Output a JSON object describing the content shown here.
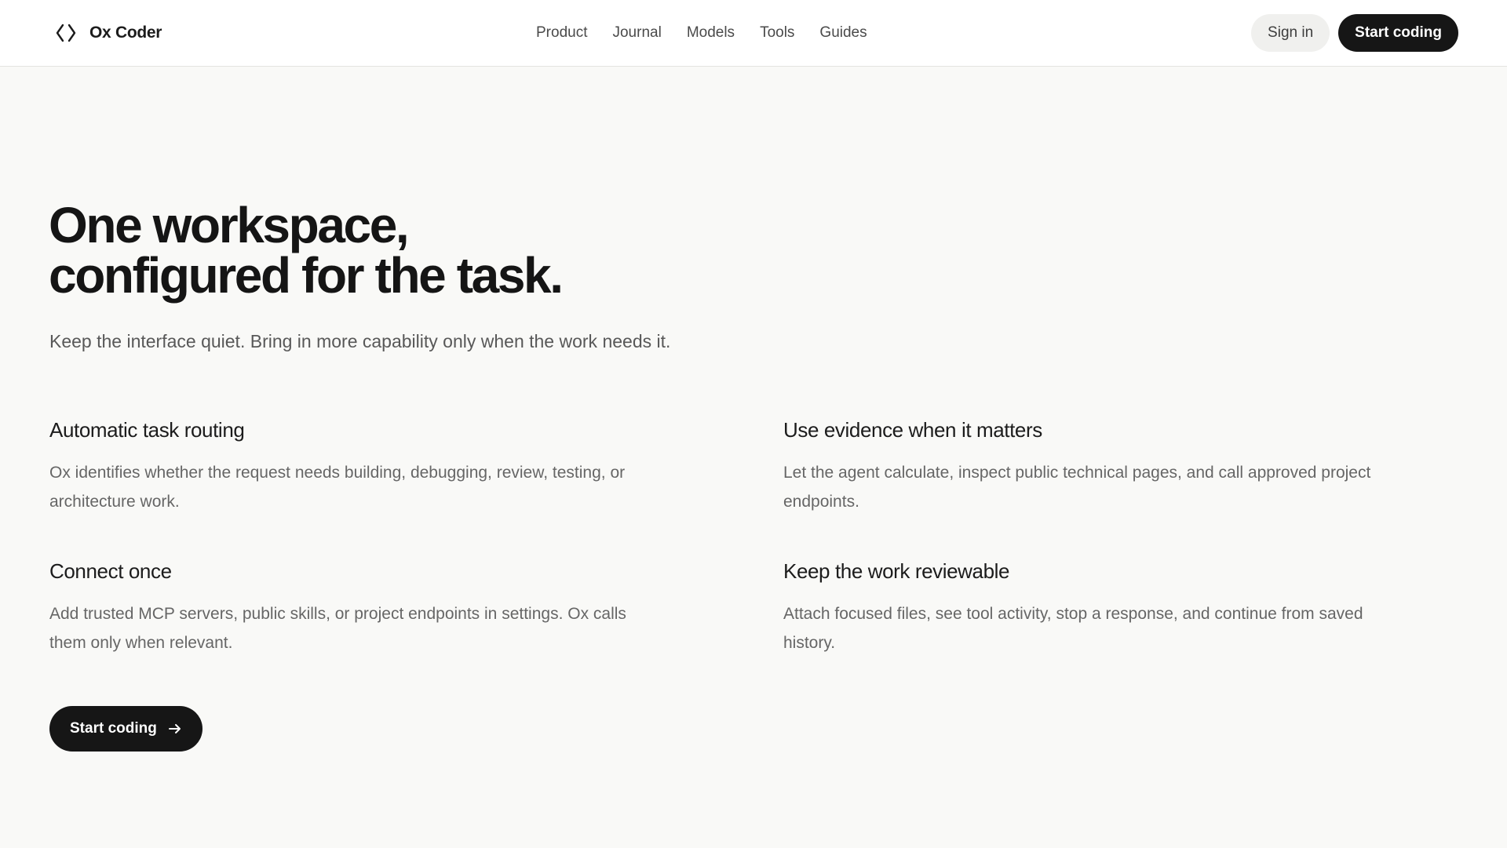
{
  "header": {
    "brand": {
      "icon": "code-brackets-icon",
      "name": "Ox Coder"
    },
    "nav": [
      {
        "label": "Product"
      },
      {
        "label": "Journal"
      },
      {
        "label": "Models"
      },
      {
        "label": "Tools"
      },
      {
        "label": "Guides"
      }
    ],
    "actions": {
      "sign_in_label": "Sign in",
      "start_label": "Start coding"
    }
  },
  "hero": {
    "title_line1": "One workspace,",
    "title_line2": "configured for the task.",
    "subtitle": "Keep the interface quiet. Bring in more capability only when the work needs it."
  },
  "features": [
    {
      "title": "Automatic task routing",
      "description": "Ox identifies whether the request needs building, debugging, review, testing, or architecture work."
    },
    {
      "title": "Use evidence when it matters",
      "description": "Let the agent calculate, inspect public technical pages, and call approved project endpoints."
    },
    {
      "title": "Connect once",
      "description": "Add trusted MCP servers, public skills, or project endpoints in settings. Ox calls them only when relevant."
    },
    {
      "title": "Keep the work reviewable",
      "description": "Attach focused files, see tool activity, stop a response, and continue from saved history."
    }
  ],
  "cta": {
    "label": "Start coding",
    "icon": "arrow-right-icon"
  },
  "colors": {
    "background": "#f9f9f7",
    "header_bg": "#ffffff",
    "primary_button": "#161616",
    "secondary_button": "#f0f0ee",
    "heading_text": "#151515",
    "body_text": "#666666"
  }
}
